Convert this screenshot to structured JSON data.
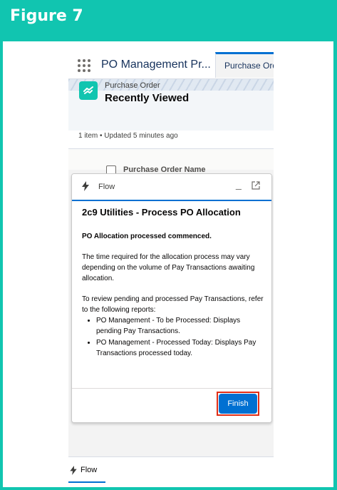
{
  "figure": {
    "title": "Figure 7"
  },
  "app_bar": {
    "app_name": "PO Management Pr...",
    "tab_label": "Purchase Orde"
  },
  "list_view": {
    "object_label": "Purchase Order",
    "view_title": "Recently Viewed",
    "meta": "1 item • Updated 5 minutes ago",
    "column_header": "Purchase Order Name"
  },
  "flow_panel": {
    "header_label": "Flow",
    "title": "2c9 Utilities - Process PO Allocation",
    "subtitle": "PO Allocation processed commenced.",
    "paragraph1": "The time required for the allocation process may vary depending on the volume of Pay Transactions awaiting allocation.",
    "paragraph2": "To review pending and processed Pay Transactions, refer to the following reports:",
    "report_items": [
      "PO Management - To be Processed: Displays pending Pay Transactions.",
      "PO Management - Processed Today: Displays Pay Transactions processed today."
    ],
    "finish_label": "Finish"
  },
  "utility_bar": {
    "tab_label": "Flow"
  },
  "colors": {
    "frame": "#11c5b0",
    "brand_blue": "#0070d2",
    "highlight_red": "#e02d16"
  },
  "icons": [
    "app-launcher-icon",
    "purchase-order-icon",
    "flow-bolt-icon",
    "minimize-icon",
    "pop-out-icon"
  ]
}
